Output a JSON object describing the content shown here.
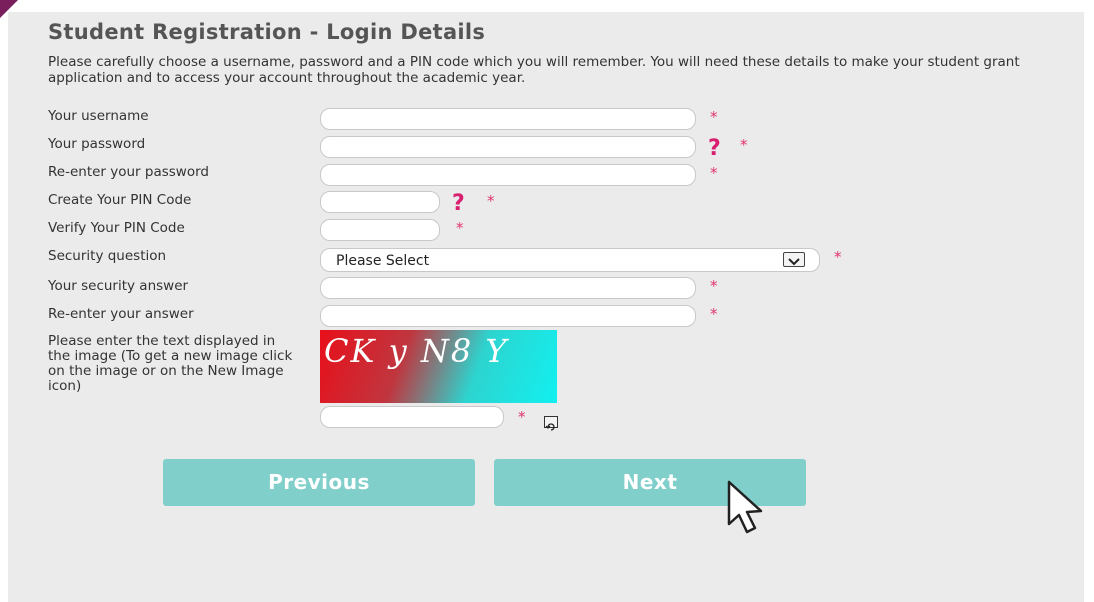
{
  "page": {
    "title": "Student Registration - Login Details",
    "intro": "Please carefully choose a username, password and a PIN code which you will remember. You will need these details to make your student grant application and to access your account throughout the academic year."
  },
  "form": {
    "required_marker": "*",
    "help_marker": "?",
    "username_label": "Your username",
    "password_label": "Your password",
    "reenter_password_label": "Re-enter your password",
    "create_pin_label": "Create Your PIN Code",
    "verify_pin_label": "Verify Your PIN Code",
    "security_question_label": "Security question",
    "security_question_value": "Please Select",
    "security_answer_label": "Your security answer",
    "reenter_answer_label": "Re-enter your answer",
    "captcha_label": "Please enter the text displayed in the image (To get a new image click on the image or on the New Image icon)",
    "captcha_image_text": "CK y N8 Y"
  },
  "buttons": {
    "previous": "Previous",
    "next": "Next"
  },
  "icons": {
    "dropdown": "chevron-down-icon",
    "refresh": "refresh-icon",
    "cursor": "pointer-cursor-icon"
  },
  "colors": {
    "button": "#81cfca",
    "required": "#e0346b",
    "help": "#d81e6e",
    "panel": "#ebebeb"
  }
}
